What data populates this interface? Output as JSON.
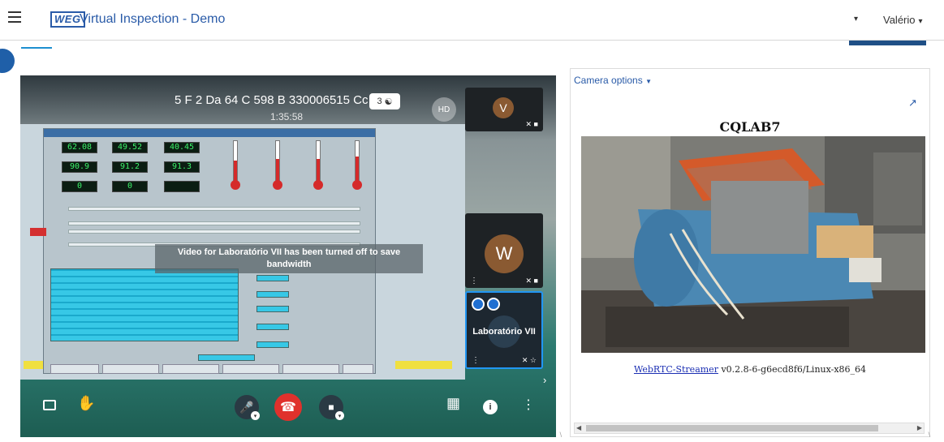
{
  "header": {
    "app_title": "Virtual Inspection - Demo",
    "logo_text": "WEG",
    "dropdown_caret": "▾",
    "user_name": "Valério",
    "user_caret": "▾"
  },
  "meeting": {
    "id": "5 F 2 Da 64 C 598 B 330006515 Cc 5",
    "elapsed": "1:35:58",
    "participant_count": "3",
    "quality_badge": "HD",
    "video_off_notice": "Video for Laboratório VII has been turned off to save bandwidth"
  },
  "participants": [
    {
      "initial": "V",
      "avatar_color": "#8a5a32"
    },
    {
      "initial": "W",
      "avatar_color": "#8a5a32"
    },
    {
      "name": "Laboratório VII"
    }
  ],
  "shared_screen": {
    "gauge_values": [
      "62.08",
      "49.52",
      "40.45",
      "90.9",
      "91.2",
      "91.3",
      "0",
      "0"
    ],
    "thermometer_levels": [
      0.55,
      0.6,
      0.6,
      0.65
    ]
  },
  "controls": {
    "hangup_color": "#e0312c"
  },
  "camera": {
    "options_label": "Camera options",
    "title": "CQLAB7",
    "streamer_link": "WebRTC-Streamer",
    "streamer_version": " v0.2.8-6-g6ecd8f6/Linux-x86_64"
  },
  "colors": {
    "brand_blue": "#2a5ba8",
    "accent_blue": "#1d8fd0",
    "active_border": "#2196f3"
  }
}
